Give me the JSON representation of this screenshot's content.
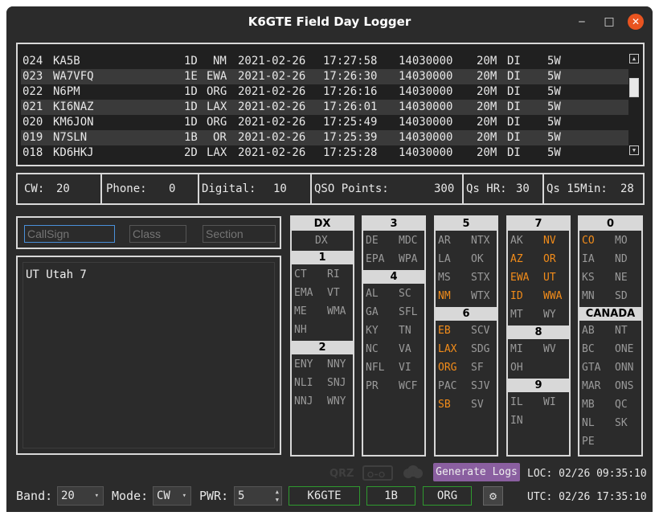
{
  "window": {
    "title": "K6GTE Field Day Logger",
    "minimize": "‒",
    "maximize": "□",
    "close": "✕"
  },
  "log": {
    "rows": [
      {
        "num": "024",
        "call": "KA5B",
        "cls": "1D",
        "sec": "NM",
        "date": "2021-02-26",
        "time": "17:27:58",
        "freq": "14030000",
        "band": "20M",
        "mode": "DI",
        "pwr": "5W"
      },
      {
        "num": "023",
        "call": "WA7VFQ",
        "cls": "1E",
        "sec": "EWA",
        "date": "2021-02-26",
        "time": "17:26:30",
        "freq": "14030000",
        "band": "20M",
        "mode": "DI",
        "pwr": "5W"
      },
      {
        "num": "022",
        "call": "N6PM",
        "cls": "1D",
        "sec": "ORG",
        "date": "2021-02-26",
        "time": "17:26:16",
        "freq": "14030000",
        "band": "20M",
        "mode": "DI",
        "pwr": "5W"
      },
      {
        "num": "021",
        "call": "KI6NAZ",
        "cls": "1D",
        "sec": "LAX",
        "date": "2021-02-26",
        "time": "17:26:01",
        "freq": "14030000",
        "band": "20M",
        "mode": "DI",
        "pwr": "5W"
      },
      {
        "num": "020",
        "call": "KM6JON",
        "cls": "1D",
        "sec": "ORG",
        "date": "2021-02-26",
        "time": "17:25:49",
        "freq": "14030000",
        "band": "20M",
        "mode": "DI",
        "pwr": "5W"
      },
      {
        "num": "019",
        "call": "N7SLN",
        "cls": "1B",
        "sec": "OR",
        "date": "2021-02-26",
        "time": "17:25:39",
        "freq": "14030000",
        "band": "20M",
        "mode": "DI",
        "pwr": "5W"
      },
      {
        "num": "018",
        "call": "KD6HKJ",
        "cls": "2D",
        "sec": "LAX",
        "date": "2021-02-26",
        "time": "17:25:28",
        "freq": "14030000",
        "band": "20M",
        "mode": "DI",
        "pwr": "5W"
      }
    ]
  },
  "stats": {
    "cw_label": "CW:",
    "cw": "20",
    "phone_label": "Phone:",
    "phone": "0",
    "digital_label": "Digital:",
    "digital": "10",
    "points_label": "QSO Points:",
    "points": "300",
    "qshr_label": "Qs HR:",
    "qshr": "30",
    "qs15_label": "Qs 15Min:",
    "qs15": "28"
  },
  "inputs": {
    "callsign_ph": "CallSign",
    "class_ph": "Class",
    "section_ph": "Section"
  },
  "info": {
    "text": "UT Utah 7"
  },
  "sections": {
    "col1": {
      "h1": "DX",
      "dx": "DX",
      "h2": "1",
      "a": [
        "CT",
        "RI",
        "EMA",
        "VT",
        "ME",
        "WMA",
        "NH"
      ],
      "h3": "2",
      "b": [
        "ENY",
        "NNY",
        "NLI",
        "SNJ",
        "NNJ",
        "WNY"
      ]
    },
    "col2": {
      "h1": "3",
      "a": [
        "DE",
        "MDC",
        "EPA",
        "WPA"
      ],
      "h2": "4",
      "b": [
        "AL",
        "SC",
        "GA",
        "SFL",
        "KY",
        "TN",
        "NC",
        "VA",
        "NFL",
        "VI",
        "PR",
        "WCF"
      ]
    },
    "col3": {
      "h1": "5",
      "a": [
        "AR",
        "NTX",
        "LA",
        "OK",
        "MS",
        "STX",
        "NM",
        "WTX"
      ],
      "h2": "6",
      "b": [
        "EB",
        "SCV",
        "LAX",
        "SDG",
        "ORG",
        "SF",
        "PAC",
        "SJV",
        "SB",
        "SV"
      ]
    },
    "col4": {
      "h1": "7",
      "a": [
        "AK",
        "NV",
        "AZ",
        "OR",
        "EWA",
        "UT",
        "ID",
        "WWA",
        "MT",
        "WY"
      ],
      "h2": "8",
      "b": [
        "MI",
        "WV",
        "OH"
      ],
      "h3": "9",
      "c": [
        "IL",
        "WI",
        "IN"
      ]
    },
    "col5": {
      "h1": "0",
      "a": [
        "CO",
        "MO",
        "IA",
        "ND",
        "KS",
        "NE",
        "MN",
        "SD"
      ],
      "h2": "CANADA",
      "b": [
        "AB",
        "NT",
        "BC",
        "ONE",
        "GTA",
        "ONN",
        "MAR",
        "ONS",
        "MB",
        "QC",
        "NL",
        "SK",
        "PE"
      ]
    },
    "highlight_color": "#f28c1a"
  },
  "status": {
    "qrz": "QRZ",
    "generate": "Generate Logs",
    "loc": "LOC: 02/26 09:35:10",
    "utc": "UTC: 02/26 17:35:10"
  },
  "controls": {
    "band_label": "Band:",
    "band": "20",
    "mode_label": "Mode:",
    "mode": "CW",
    "pwr_label": "PWR:",
    "pwr": "5",
    "call": "K6GTE",
    "cls": "1B",
    "sec": "ORG"
  },
  "icons": {
    "radio": "radio-icon",
    "cloud": "cloud-icon",
    "gear": "gear-icon",
    "dropdown": "▾",
    "spin_up": "▲",
    "spin_down": "▼"
  }
}
